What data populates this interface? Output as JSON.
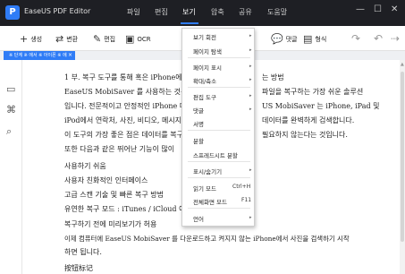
{
  "app": {
    "title": "EaseUS PDF Editor",
    "logo_letter": "P"
  },
  "menubar": {
    "items": [
      "파일",
      "편집",
      "보기",
      "압축",
      "공유",
      "도움말"
    ],
    "active": "보기"
  },
  "window_controls": [
    "—",
    "☐",
    "✕"
  ],
  "toolbar": {
    "items": [
      {
        "label": "생성",
        "icon": "plus-icon"
      },
      {
        "label": "변환",
        "icon": "convert-icon"
      },
      {
        "label": "편집",
        "icon": "edit-icon"
      },
      {
        "label": "OCR",
        "icon": "ocr-icon"
      },
      {
        "label": "댓글",
        "icon": "comment-icon"
      },
      {
        "label": "형식",
        "icon": "form-icon"
      }
    ]
  },
  "tab": {
    "label": "※ 단계 ※ 에서 ※ 아이폰 ※ 에",
    "close": "×"
  },
  "document": {
    "lines": [
      "1 부. 복구 도구를 통해 혹은 iPhone에",
      "EaseUS MobiSaver 를 사용하는 것은 iPhone",
      "입니다. 전문적이고 안정적인 iPhone 데이터",
      "iPod에서 연락처, 사진, 비디오, 메시지",
      "이 도구의 가장 좋은 점은 데이터를 복구",
      "또한 다음과 같은 뛰어난 기능이 많이",
      "사용하기 쉬움",
      "사용자 친화적인 인터페이스",
      "고급 스캔 기술 및 빠른 복구 방법",
      "유연한 복구 모드 : iTunes / iCloud 에서",
      "복구하기 전에 미리보기가 허용",
      "이제 컴퓨터에 EaseUS MobiSaver 를 다운로드하고 켜지지 않는 iPhone에서 사진을 검색하기 시작",
      "하면 됩니다.",
      "按钮标记"
    ],
    "right_fragments": [
      "는 방법",
      "파일을 복구하는 가장 쉬운 솔루션",
      "US MobiSaver 는 iPhone, iPad 및",
      "데이터를 완벽하게 검색합니다.",
      "필요하지 않는다는 것입니다."
    ]
  },
  "view_menu": {
    "items": [
      {
        "label": "보기 회전",
        "arrow": true
      },
      {
        "label": "페이지 탐색",
        "arrow": true
      },
      {
        "label": "페이지 표시",
        "arrow": true
      },
      {
        "label": "확대/축소",
        "arrow": true
      },
      {
        "label": "편집 도구",
        "arrow": true
      },
      {
        "label": "댓글",
        "arrow": true
      },
      {
        "label": "서명",
        "arrow": false
      },
      {
        "label": "분할",
        "arrow": false
      },
      {
        "label": "스프레드시트 분할",
        "arrow": false
      },
      {
        "label": "표시/숨기기",
        "arrow": true
      },
      {
        "label": "읽기 모드",
        "shortcut": "Ctrl+H"
      },
      {
        "label": "전체화면 모드",
        "shortcut": "F11"
      },
      {
        "label": "언어",
        "arrow": true
      }
    ]
  }
}
